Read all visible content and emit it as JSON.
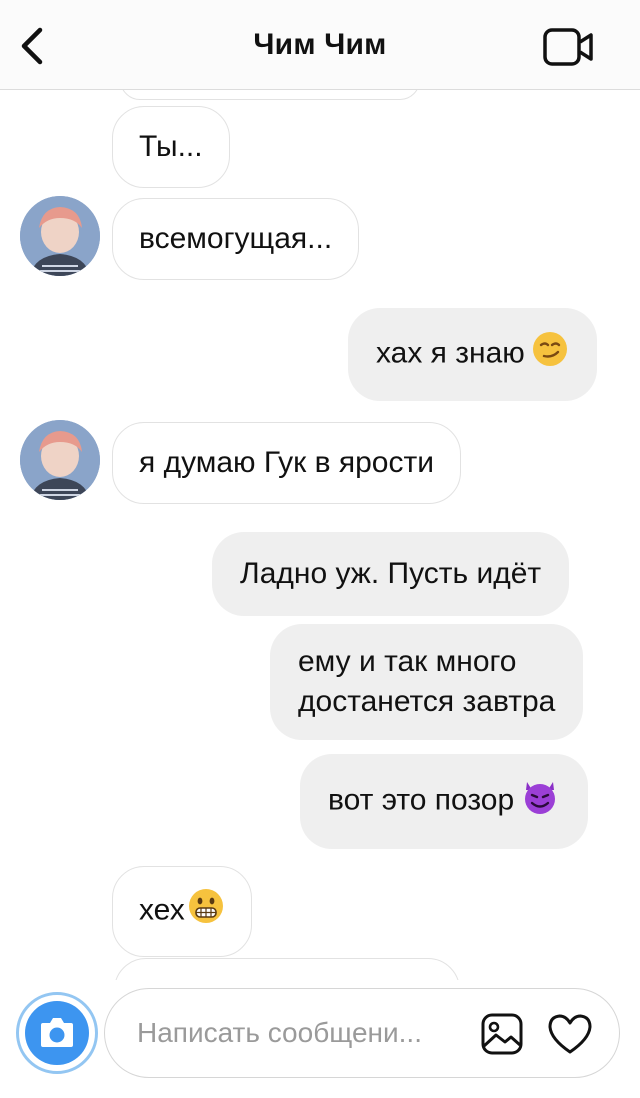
{
  "header": {
    "title": "Чим Чим",
    "back_icon": "chevron-left-icon",
    "video_icon": "video-call-icon"
  },
  "messages": [
    {
      "side": "incoming",
      "text": "Ты..."
    },
    {
      "side": "incoming",
      "text": "всемогущая..."
    },
    {
      "side": "outgoing",
      "text": "хах я знаю",
      "emoji": "smirk-face-icon"
    },
    {
      "side": "incoming",
      "text": "я думаю Гук в ярости"
    },
    {
      "side": "outgoing",
      "text": "Ладно уж. Пусть идёт"
    },
    {
      "side": "outgoing",
      "lines": [
        "ему и так много",
        "достанется завтра"
      ]
    },
    {
      "side": "outgoing",
      "text": "вот это позор",
      "emoji": "smiling-devil-icon"
    },
    {
      "side": "incoming",
      "text": "хех",
      "emoji": "grimacing-face-icon"
    }
  ],
  "composer": {
    "placeholder": "Написать сообщени...",
    "camera_icon": "camera-icon",
    "gallery_icon": "gallery-icon",
    "like_icon": "heart-icon"
  },
  "colors": {
    "outgoing_bubble": "#efefef",
    "incoming_border": "#e2e2e2",
    "camera_blue": "#3d95f0",
    "header_bg": "#fbfbfb"
  }
}
